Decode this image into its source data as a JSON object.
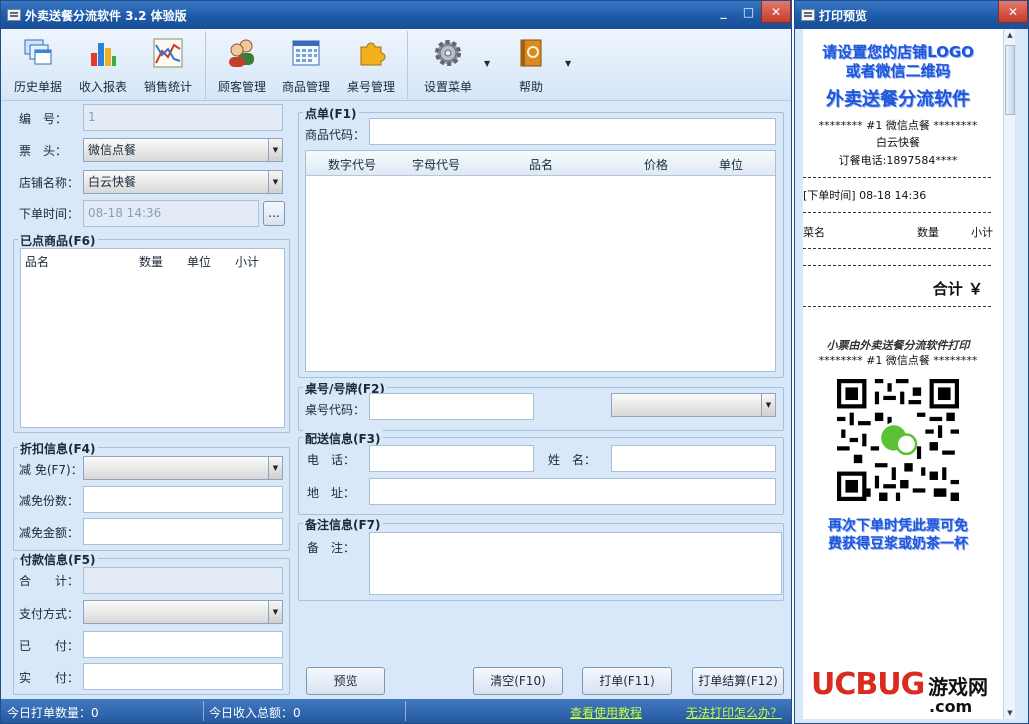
{
  "main_window": {
    "title": "外卖送餐分流软件 3.2 体验版",
    "controls": {
      "minimize": "_",
      "maximize": "□",
      "close": "✕"
    }
  },
  "toolbar": {
    "items": [
      {
        "label": "历史单据",
        "icon": "history-docs-icon"
      },
      {
        "label": "收入报表",
        "icon": "bar-chart-icon"
      },
      {
        "label": "销售统计",
        "icon": "line-chart-icon"
      },
      {
        "label": "顾客管理",
        "icon": "users-icon"
      },
      {
        "label": "商品管理",
        "icon": "grid-calendar-icon"
      },
      {
        "label": "桌号管理",
        "icon": "puzzle-icon"
      },
      {
        "label": "设置菜单",
        "icon": "gear-icon"
      },
      {
        "label": "帮助",
        "icon": "help-book-icon"
      }
    ],
    "dropdown_arrow": "▼"
  },
  "order": {
    "number_label": "编　号：",
    "number_value": "1",
    "ticket_label": "票　头：",
    "ticket_value": "微信点餐",
    "store_label": "店铺名称：",
    "store_value": "白云快餐",
    "time_label": "下单时间：",
    "time_value": "08-18 14:36",
    "time_button": "..."
  },
  "items_group": {
    "title": "已点商品(F6)",
    "columns": [
      "品名",
      "数量",
      "单位",
      "小计"
    ]
  },
  "discount_group": {
    "title": "折扣信息(F4)",
    "reduce_label": "减 免(F7)：",
    "reduce_value": "",
    "count_label": "减免份数：",
    "count_value": "",
    "amount_label": "减免金额：",
    "amount_value": ""
  },
  "payment_group": {
    "title": "付款信息(F5)",
    "total_label": "合　　计：",
    "total_value": "",
    "method_label": "支付方式：",
    "method_value": "",
    "paid_label": "已　　付：",
    "paid_value": "",
    "actual_label": "实　　付：",
    "actual_value": ""
  },
  "order_group": {
    "title": "点单(F1)",
    "code_label": "商品代码：",
    "code_value": "",
    "columns": [
      "数字代号",
      "字母代号",
      "品名",
      "价格",
      "单位"
    ]
  },
  "table_group": {
    "title": "桌号/号牌(F2)",
    "code_label": "桌号代码：",
    "code_value": "",
    "select_value": ""
  },
  "delivery_group": {
    "title": "配送信息(F3)",
    "phone_label": "电　话：",
    "phone_value": "",
    "name_label": "姓　名：",
    "name_value": "",
    "address_label": "地　址：",
    "address_value": ""
  },
  "note_group": {
    "title": "备注信息(F7)",
    "note_label": "备　注：",
    "note_value": ""
  },
  "buttons": {
    "preview": "预览",
    "clear": "清空(F10)",
    "print": "打单(F11)",
    "print_settle": "打单结算(F12)"
  },
  "statusbar": {
    "today_orders": "今日打单数量：0",
    "today_income": "今日收入总额：0",
    "help_link": "查看使用教程",
    "print_fail_link": "无法打印怎么办？"
  },
  "preview_window": {
    "title": "打印预览",
    "close": "✕"
  },
  "receipt": {
    "logo_line1": "请设置您的店铺LOGO",
    "logo_line2": "或者微信二维码",
    "app_name": "外卖送餐分流软件",
    "header_line": "********  #1 微信点餐  ********",
    "store": "白云快餐",
    "phone": "订餐电话:1897584****",
    "time_line": "[下单时间] 08-18 14:36",
    "col_dish": "菜名",
    "col_qty": "数量",
    "col_sub": "小计",
    "total": "合计 ￥",
    "footer_line1": "小票由外卖送餐分流软件打印",
    "footer_header": "********  #1 微信点餐  ********",
    "promo_line1": "再次下单时凭此票可免",
    "promo_line2": "费获得豆浆或奶茶一杯"
  },
  "watermark": {
    "brand": "UCBUG",
    "cn": "游戏网",
    "domain": ".com"
  },
  "colors": {
    "titlebar": "#1d5aa8",
    "window_bg": "#d9e8f8",
    "receipt_blue": "#1f56d6",
    "link_green": "#c7ff3a"
  }
}
